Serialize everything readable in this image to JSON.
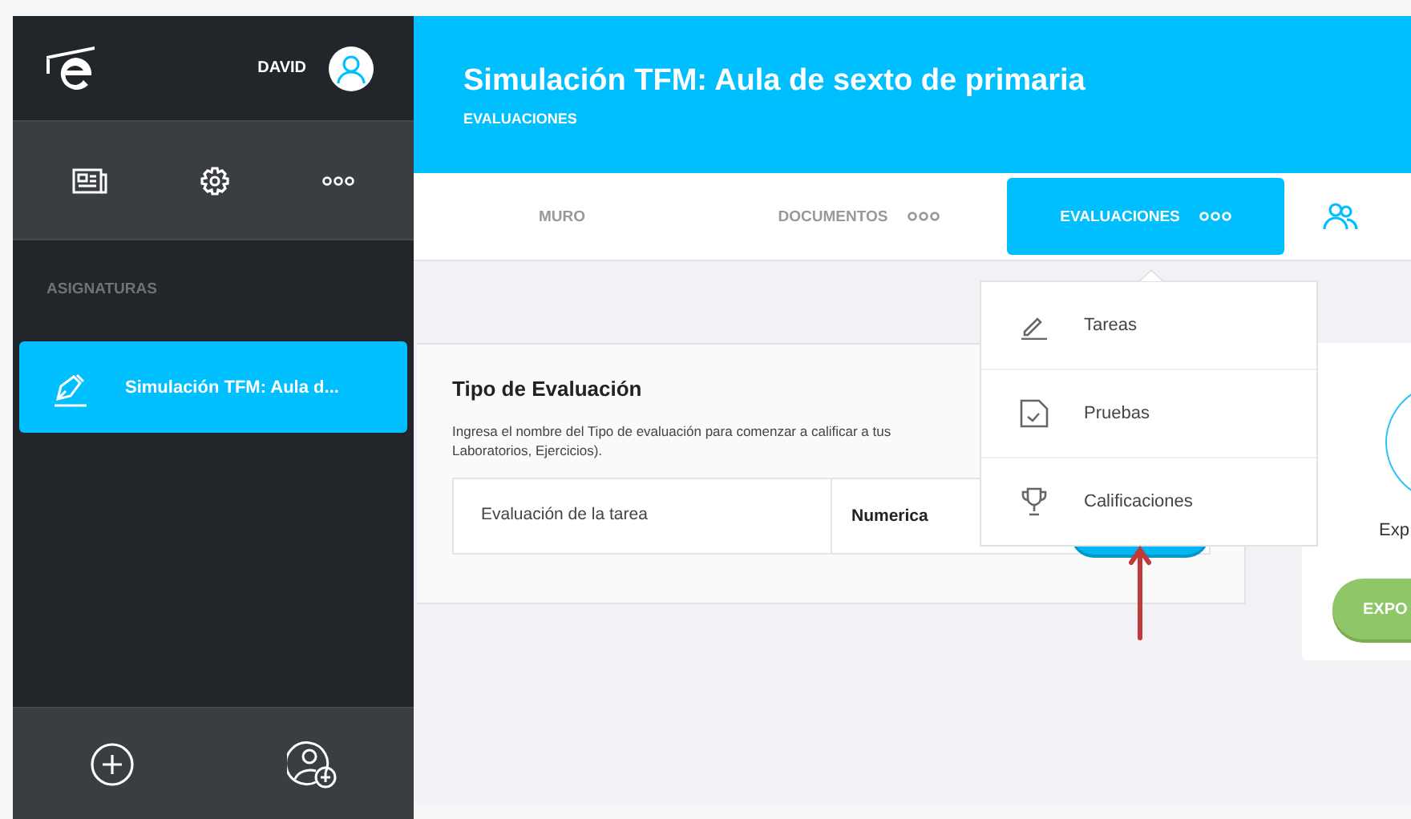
{
  "sidebar": {
    "user": "DAVID",
    "section_label": "ASIGNATURAS",
    "subjects": [
      {
        "label": "Simulación TFM: Aula d...",
        "selected": true
      }
    ]
  },
  "header": {
    "title": "Simulación TFM: Aula de sexto de primaria",
    "subtitle": "EVALUACIONES"
  },
  "tabs": [
    {
      "label": "MURO",
      "selected": false,
      "more": false
    },
    {
      "label": "DOCUMENTOS",
      "selected": false,
      "more": true
    },
    {
      "label": "EVALUACIONES",
      "selected": true,
      "more": true
    }
  ],
  "dropdown": [
    {
      "kind": "pencil",
      "label": "Tareas"
    },
    {
      "kind": "test",
      "label": "Pruebas"
    },
    {
      "kind": "trophy",
      "label": "Calificaciones"
    }
  ],
  "card": {
    "title": "Tipo de Evaluación",
    "description_lines": [
      "Ingresa el nombre del Tipo de evaluación para comenzar a calificar a tus",
      "Laboratorios, Ejercicios)."
    ],
    "row": {
      "name": "Evaluación de la tarea",
      "type": "Numerica"
    }
  },
  "right_card": {
    "text": "Exp",
    "button": "EXPO"
  }
}
